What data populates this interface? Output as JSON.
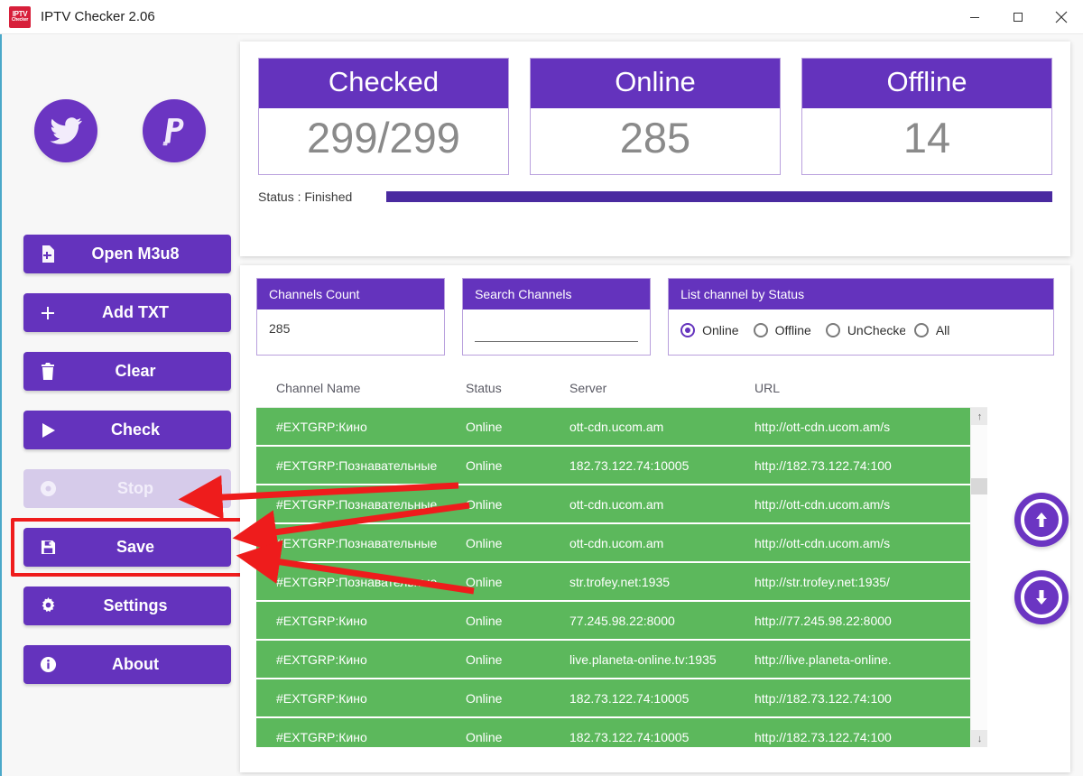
{
  "window": {
    "title": "IPTV Checker 2.06",
    "logo_line1": "IPTV",
    "logo_line2": "Checker",
    "minimize_label": "–",
    "maximize_label": "□",
    "close_label": "✕"
  },
  "colors": {
    "purple": "#6433bd",
    "purple_dark": "#4a2aa0",
    "green_row": "#5cb85c",
    "annotation_red": "#ef1c1c",
    "disabled": "#d6cbea"
  },
  "sidebar": {
    "social": [
      {
        "name": "twitter",
        "label": "Twitter"
      },
      {
        "name": "paypal",
        "label": "PayPal"
      }
    ],
    "buttons": [
      {
        "label": "Open M3u8",
        "icon": "file-plus-icon",
        "disabled": false
      },
      {
        "label": "Add TXT",
        "icon": "plus-icon",
        "disabled": false
      },
      {
        "label": "Clear",
        "icon": "trash-icon",
        "disabled": false
      },
      {
        "label": "Check",
        "icon": "play-icon",
        "disabled": false
      },
      {
        "label": "Stop",
        "icon": "stop-circle-icon",
        "disabled": true
      },
      {
        "label": "Save",
        "icon": "save-disk-icon",
        "disabled": false,
        "highlighted": true
      },
      {
        "label": "Settings",
        "icon": "gear-icon",
        "disabled": false
      },
      {
        "label": "About",
        "icon": "info-icon",
        "disabled": false
      }
    ]
  },
  "stats": {
    "cards": [
      {
        "title": "Checked",
        "value": "299/299"
      },
      {
        "title": "Online",
        "value": "285"
      },
      {
        "title": "Offline",
        "value": "14"
      }
    ],
    "status_label": "Status : Finished",
    "progress_percent": 100
  },
  "filters": {
    "channels_count": {
      "title": "Channels Count",
      "value": "285"
    },
    "search": {
      "title": "Search Channels",
      "value": "",
      "placeholder": ""
    },
    "status_filter": {
      "title": "List channel by Status",
      "options": [
        {
          "label": "Online",
          "selected": true
        },
        {
          "label": "Offline",
          "selected": false
        },
        {
          "label": "UnChecked",
          "selected": false,
          "clipped": true
        },
        {
          "label": "All",
          "selected": false
        }
      ]
    }
  },
  "table": {
    "columns": [
      "Channel Name",
      "Status",
      "Server",
      "URL"
    ],
    "rows": [
      {
        "name": "#EXTGRP:Кино",
        "status": "Online",
        "server": "ott-cdn.ucom.am",
        "url": "http://ott-cdn.ucom.am/s"
      },
      {
        "name": "#EXTGRP:Познавательные",
        "status": "Online",
        "server": "182.73.122.74:10005",
        "url": "http://182.73.122.74:100"
      },
      {
        "name": "#EXTGRP:Познавательные",
        "status": "Online",
        "server": "ott-cdn.ucom.am",
        "url": "http://ott-cdn.ucom.am/s"
      },
      {
        "name": "#EXTGRP:Познавательные",
        "status": "Online",
        "server": "ott-cdn.ucom.am",
        "url": "http://ott-cdn.ucom.am/s"
      },
      {
        "name": "#EXTGRP:Познавательные",
        "status": "Online",
        "server": "str.trofey.net:1935",
        "url": "http://str.trofey.net:1935/"
      },
      {
        "name": "#EXTGRP:Кино",
        "status": "Online",
        "server": "77.245.98.22:8000",
        "url": "http://77.245.98.22:8000"
      },
      {
        "name": "#EXTGRP:Кино",
        "status": "Online",
        "server": "live.planeta-online.tv:1935",
        "url": "http://live.planeta-online."
      },
      {
        "name": "#EXTGRP:Кино",
        "status": "Online",
        "server": "182.73.122.74:10005",
        "url": "http://182.73.122.74:100"
      },
      {
        "name": "#EXTGRP:Кино",
        "status": "Online",
        "server": "182.73.122.74:10005",
        "url": "http://182.73.122.74:100"
      }
    ],
    "scroll_up_label": "↑",
    "scroll_down_label": "↓"
  },
  "nav": {
    "up_label": "move-up",
    "down_label": "move-down"
  },
  "annotations": {
    "arrow_count": 3,
    "highlight_target": "Save"
  }
}
